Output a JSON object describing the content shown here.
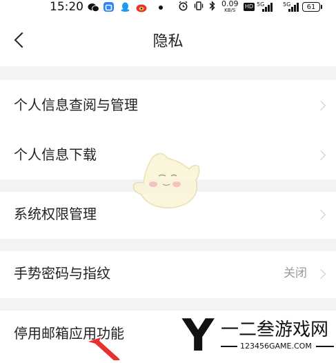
{
  "status_bar": {
    "time": "15:20",
    "net_speed_value": "0.09",
    "net_speed_unit": "KB/S",
    "hd_badge": "HD",
    "sig1_label": "5G",
    "sig2_label": "5G",
    "battery": "61",
    "icons": [
      "wechat-icon",
      "app-icon",
      "qq-icon",
      "weibo-icon",
      "alarm-icon",
      "vibrate-icon",
      "bluetooth-icon"
    ]
  },
  "header": {
    "title": "隐私",
    "back_icon": "chevron-left-icon"
  },
  "settings": {
    "rows": [
      {
        "label": "个人信息查阅与管理"
      },
      {
        "label": "个人信息下载"
      },
      {
        "label": "系统权限管理"
      },
      {
        "label": "手势密码与指纹",
        "value": "关闭"
      },
      {
        "label": "停用邮箱应用功能"
      }
    ]
  },
  "watermark": {
    "letter": "Y",
    "name": "一二叁游戏网",
    "url": "123456GAME.COM"
  },
  "colors": {
    "background": "#ffffff",
    "section_gap": "#f3f3f3",
    "text": "#222222",
    "secondary_text": "#9a9a9a",
    "chevron": "#c8c8c8",
    "annotation_arrow": "#e8312f"
  }
}
